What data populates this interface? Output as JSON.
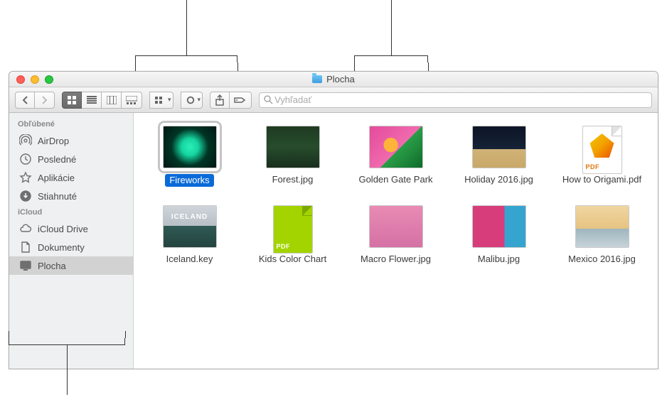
{
  "window": {
    "title": "Plocha"
  },
  "search": {
    "placeholder": "Vyhľadať"
  },
  "sidebar": {
    "sections": [
      {
        "header": "Obľúbené",
        "items": [
          {
            "label": "AirDrop",
            "icon": "airdrop"
          },
          {
            "label": "Posledné",
            "icon": "recents"
          },
          {
            "label": "Aplikácie",
            "icon": "apps"
          },
          {
            "label": "Stiahnuté",
            "icon": "downloads"
          }
        ]
      },
      {
        "header": "iCloud",
        "items": [
          {
            "label": "iCloud Drive",
            "icon": "cloud"
          },
          {
            "label": "Dokumenty",
            "icon": "documents"
          },
          {
            "label": "Plocha",
            "icon": "desktop",
            "selected": true
          }
        ]
      }
    ]
  },
  "files": [
    {
      "name": "Fireworks",
      "thumb": "img-fireworks",
      "selected": true
    },
    {
      "name": "Forest.jpg",
      "thumb": "img-forest"
    },
    {
      "name": "Golden Gate Park",
      "thumb": "img-gate"
    },
    {
      "name": "Holiday 2016.jpg",
      "thumb": "img-holiday"
    },
    {
      "name": "How to Origami.pdf",
      "thumb": "pdf-origami"
    },
    {
      "name": "Iceland.key",
      "thumb": "img-iceland",
      "overlay": "ICELAND"
    },
    {
      "name": "Kids Color Chart",
      "thumb": "pdf-kids"
    },
    {
      "name": "Macro Flower.jpg",
      "thumb": "img-macro"
    },
    {
      "name": "Malibu.jpg",
      "thumb": "img-malibu"
    },
    {
      "name": "Mexico 2016.jpg",
      "thumb": "img-mexico"
    }
  ],
  "pdf_label": "PDF"
}
